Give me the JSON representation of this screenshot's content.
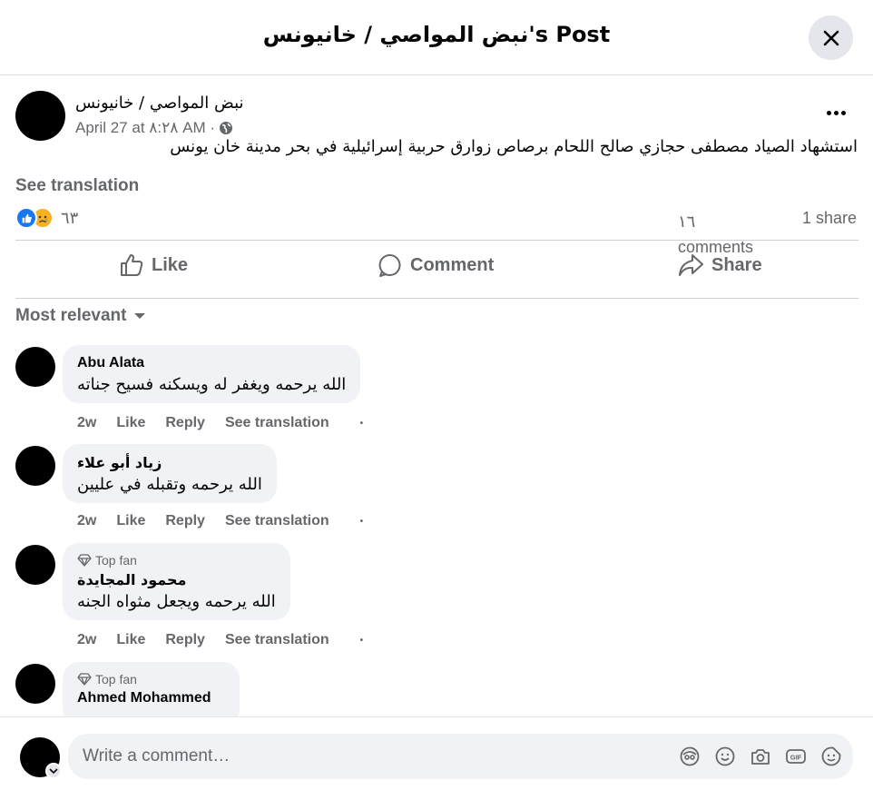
{
  "header": {
    "title": "نبض المواصي / خانيونس's Post"
  },
  "post": {
    "page_name": "نبض المواصي / خانيونس",
    "timestamp": "April 27 at ٨:٢٨ AM ·",
    "text": "استشهاد الصياد مصطفى حجازي صالح اللحام برصاص زوارق حربية إسرائيلية في بحر مدينة خان يونس",
    "see_translation": "See translation",
    "reaction_count": "٦٣",
    "comments_count": "١٦ comments",
    "shares": "1 share"
  },
  "actions": {
    "like": "Like",
    "comment": "Comment",
    "share": "Share"
  },
  "filter": {
    "label": "Most relevant"
  },
  "comments": [
    {
      "top_fan": "",
      "author": "Abu Alata",
      "text": "الله يرحمه ويغفر له ويسكنه فسيح جناته",
      "time": "2w",
      "like": "Like",
      "reply": "Reply",
      "translate": "See translation"
    },
    {
      "top_fan": "",
      "author": "زياد أبو علاء",
      "text": "الله يرحمه وتقبله في عليين",
      "time": "2w",
      "like": "Like",
      "reply": "Reply",
      "translate": "See translation"
    },
    {
      "top_fan": "Top fan",
      "author": "محمود المجايدة",
      "text": "الله يرحمه ويجعل مثواه الجنه",
      "time": "2w",
      "like": "Like",
      "reply": "Reply",
      "translate": "See translation"
    },
    {
      "top_fan": "Top fan",
      "author": "Ahmed Mohammed",
      "text": "",
      "time": "",
      "like": "",
      "reply": "",
      "translate": ""
    }
  ],
  "composer": {
    "placeholder": "Write a comment…"
  },
  "icons": [
    "close-icon",
    "globe-icon",
    "more-icon",
    "like-reaction-icon",
    "sad-reaction-icon",
    "thumbs-up-icon",
    "comment-icon",
    "share-icon",
    "chevron-down-icon",
    "diamond-icon",
    "avatar-sticker-icon",
    "emoji-icon",
    "camera-icon",
    "gif-icon",
    "sticker-icon"
  ],
  "colors": {
    "muted": "#65676b",
    "bubble": "#f0f2f5",
    "like_blue": "#1877f2",
    "sad_yellow": "#f7b125"
  }
}
